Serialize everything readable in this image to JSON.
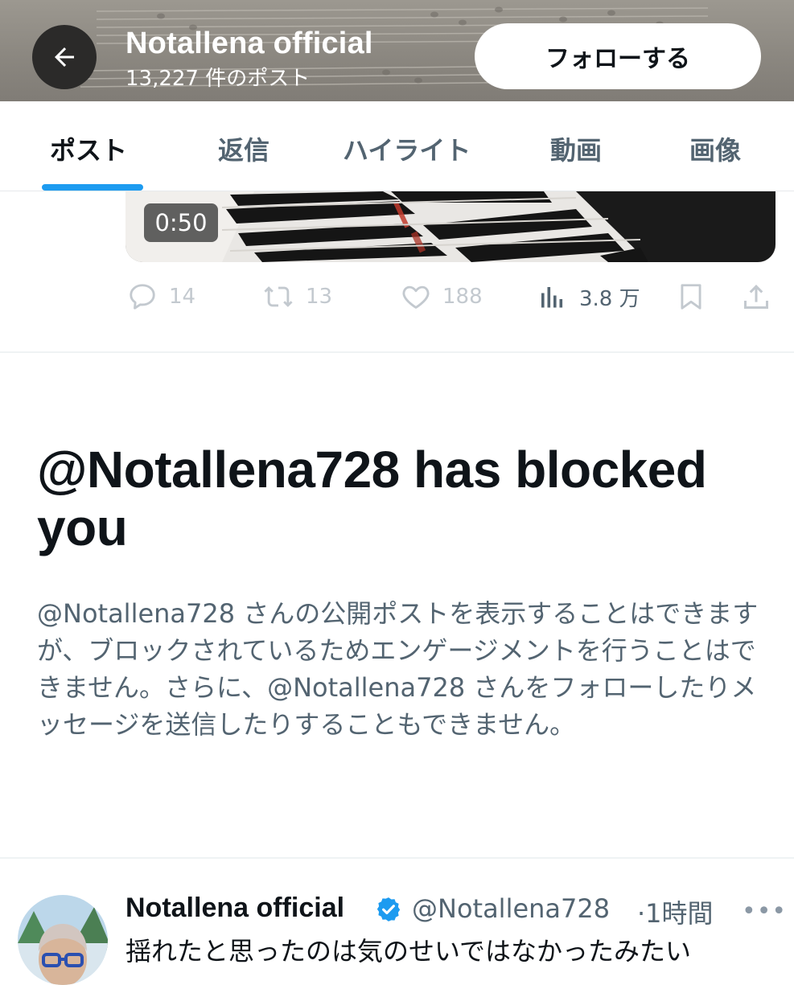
{
  "header": {
    "title": "Notallena official",
    "post_count": "13,227 件のポスト",
    "follow_label": "フォローする"
  },
  "tabs": [
    {
      "label": "ポスト",
      "active": true
    },
    {
      "label": "返信",
      "active": false
    },
    {
      "label": "ハイライト",
      "active": false
    },
    {
      "label": "動画",
      "active": false
    },
    {
      "label": "画像",
      "active": false
    }
  ],
  "media": {
    "duration": "0:50"
  },
  "actions": {
    "replies": "14",
    "reposts": "13",
    "likes": "188",
    "views": "3.8 万"
  },
  "blocked": {
    "title": "@Notallena728 has blocked you",
    "description": "@Notallena728 さんの公開ポストを表示することはできますが、ブロックされているためエンゲージメントを行うことはできません。さらに、@Notallena728 さんをフォローしたりメッセージを送信したりすることもできません。"
  },
  "post": {
    "name": "Notallena official",
    "handle": "@Notallena728",
    "time": "·1時間",
    "text": "揺れたと思ったのは気のせいではなかったみたい"
  },
  "colors": {
    "accent": "#1d9bf0",
    "text_primary": "#0f1419",
    "text_secondary": "#536471"
  }
}
